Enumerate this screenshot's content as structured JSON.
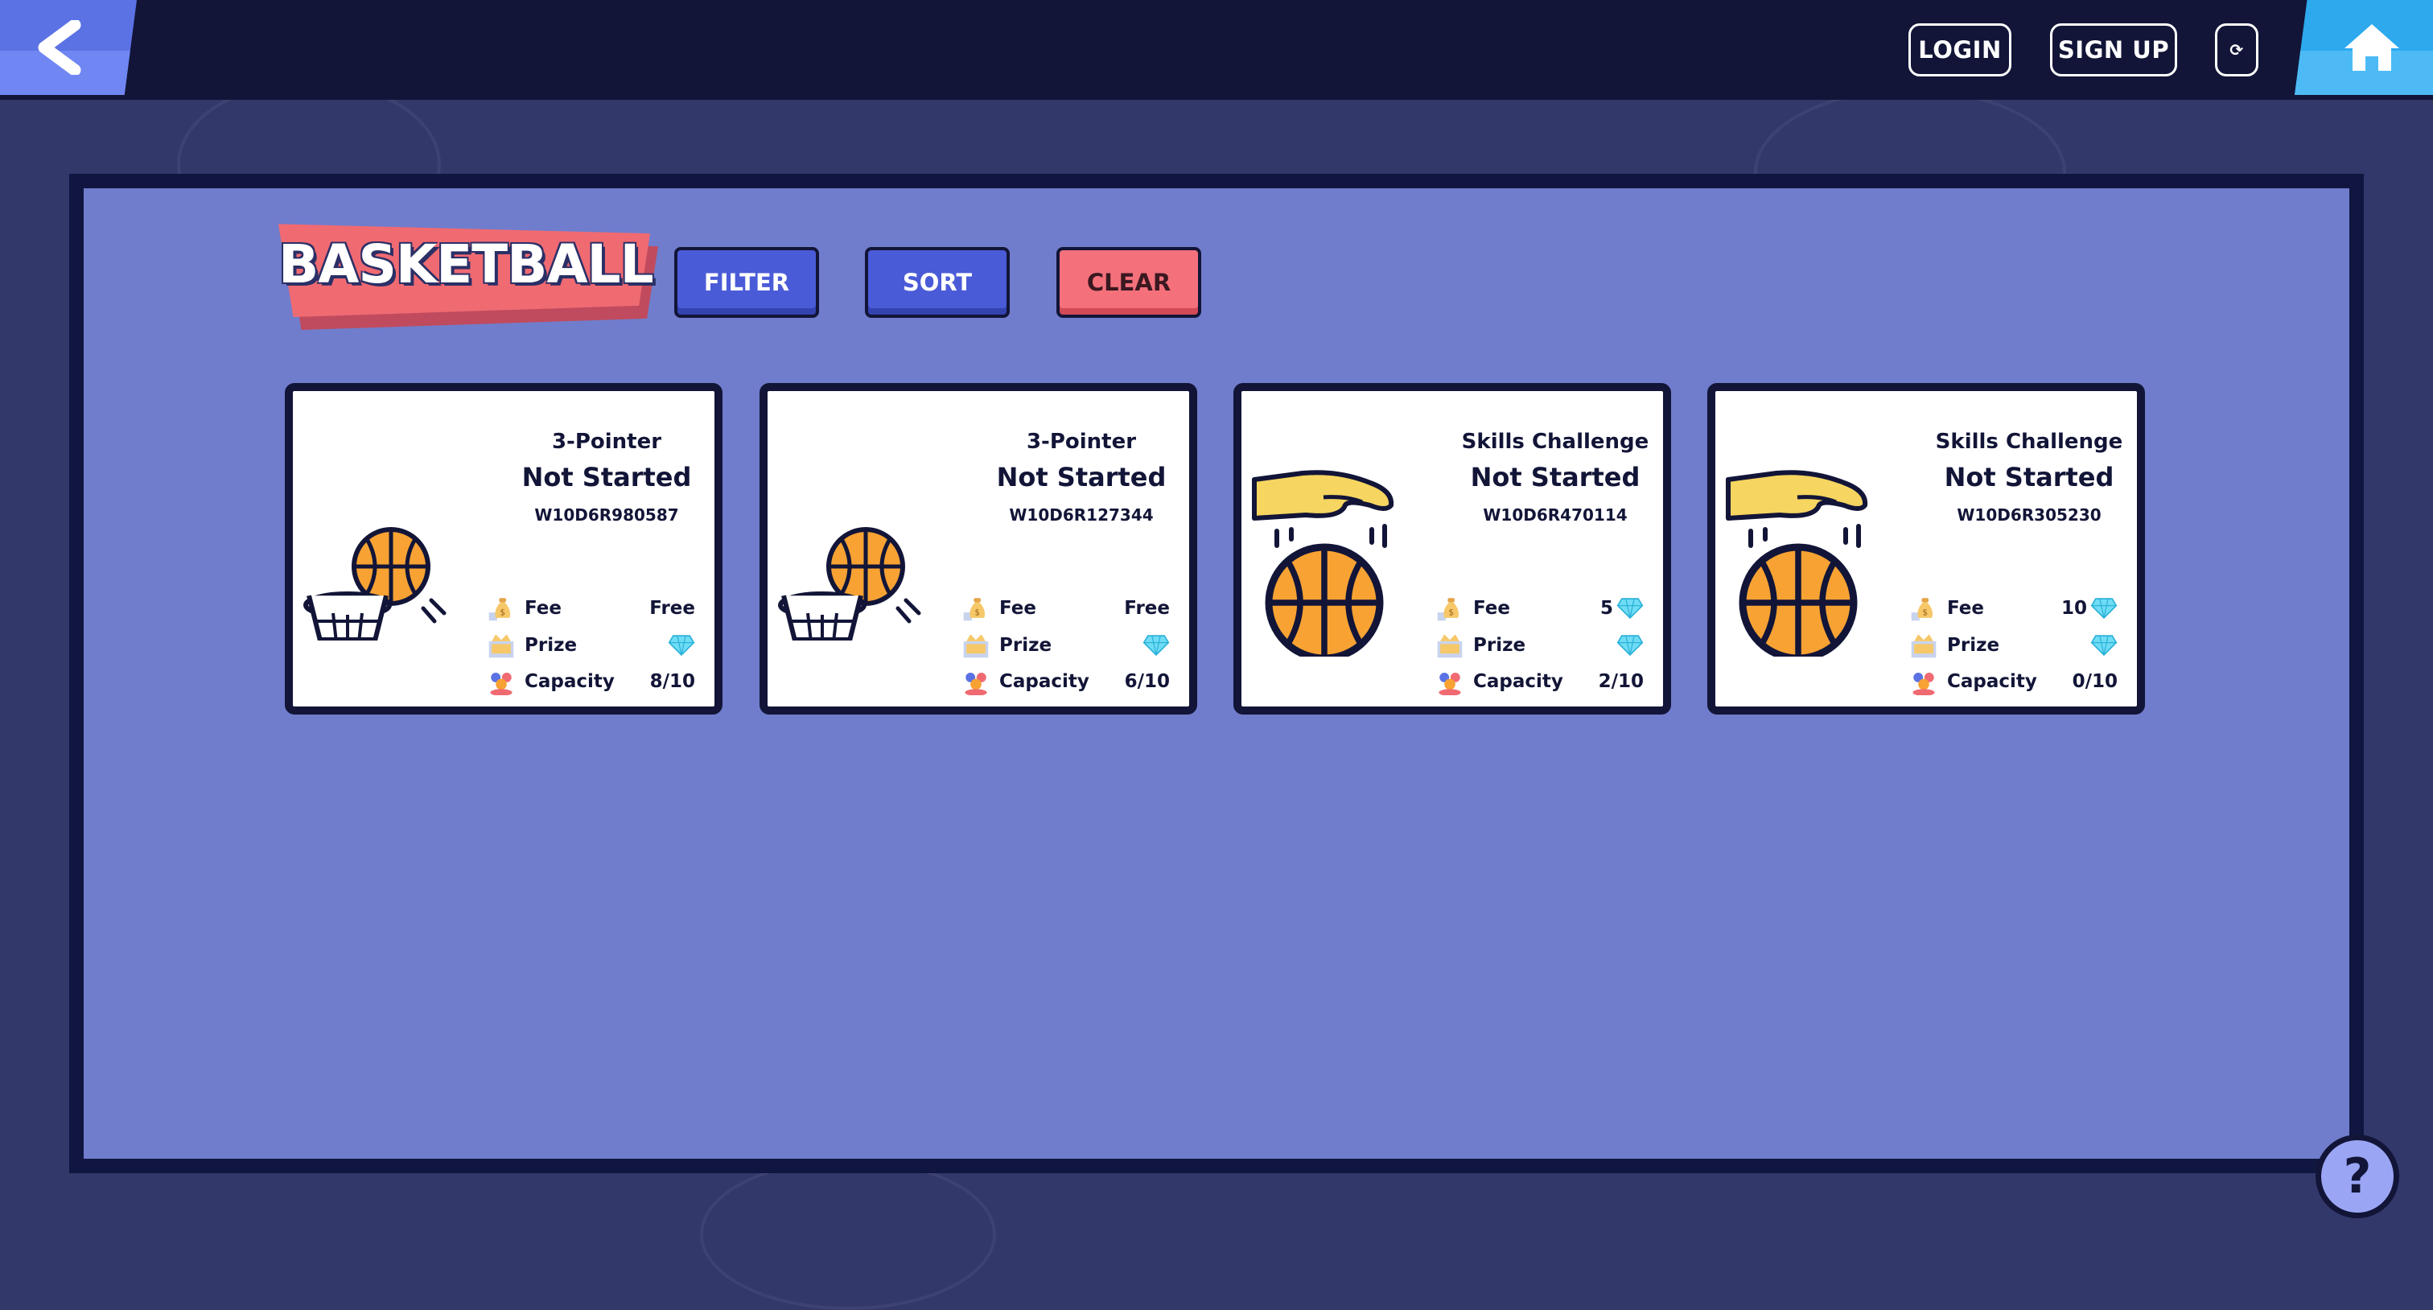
{
  "header": {
    "login_label": "LOGIN",
    "signup_label": "SIGN UP",
    "refresh_label": "⟳",
    "back_icon": "back-arrow-icon",
    "home_icon": "home-icon"
  },
  "page": {
    "title": "BASKETBALL",
    "filter_label": "FILTER",
    "sort_label": "SORT",
    "clear_label": "CLEAR",
    "help_label": "?"
  },
  "labels": {
    "fee": "Fee",
    "prize": "Prize",
    "capacity": "Capacity"
  },
  "cards": [
    {
      "category": "3-Pointer",
      "status": "Not Started",
      "code": "W10D6R980587",
      "fee": "Free",
      "fee_gem": false,
      "capacity": "8/10",
      "image": "hoop-ball-icon"
    },
    {
      "category": "3-Pointer",
      "status": "Not Started",
      "code": "W10D6R127344",
      "fee": "Free",
      "fee_gem": false,
      "capacity": "6/10",
      "image": "hoop-ball-icon"
    },
    {
      "category": "Skills Challenge",
      "status": "Not Started",
      "code": "W10D6R470114",
      "fee": "5",
      "fee_gem": true,
      "capacity": "2/10",
      "image": "dribble-hand-icon"
    },
    {
      "category": "Skills Challenge",
      "status": "Not Started",
      "code": "W10D6R305230",
      "fee": "10",
      "fee_gem": true,
      "capacity": "0/10",
      "image": "dribble-hand-icon"
    }
  ],
  "colors": {
    "background": "#33386b",
    "topbar": "#121537",
    "panel": "#707dcc",
    "accent_blue": "#4a5bd8",
    "accent_red": "#f4717c",
    "gem": "#5fd4f0"
  }
}
